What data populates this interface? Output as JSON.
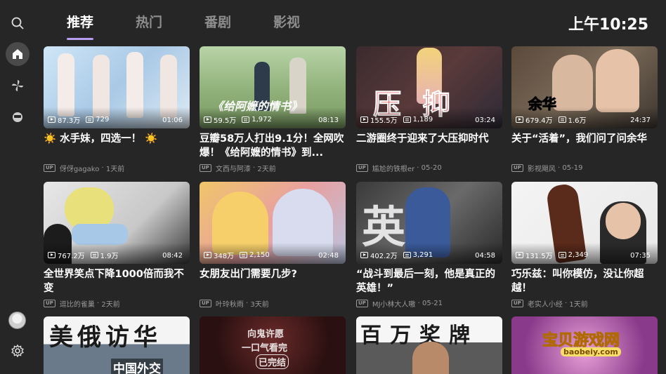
{
  "tabs": [
    {
      "label": "推荐",
      "active": true
    },
    {
      "label": "热门",
      "active": false
    },
    {
      "label": "番剧",
      "active": false
    },
    {
      "label": "影视",
      "active": false
    }
  ],
  "clock": "上午10:25",
  "sidebar": {
    "items": [
      {
        "icon": "search-icon"
      },
      {
        "icon": "home-icon",
        "active": true
      },
      {
        "icon": "pinwheel-icon"
      },
      {
        "icon": "bilibili-tv-icon"
      },
      {
        "icon": "avatar"
      },
      {
        "icon": "gear-icon"
      }
    ]
  },
  "videos": [
    {
      "title": "☀️ 水手妹，四选一！ ☀️",
      "author": "伢伢gagako",
      "date": "1天前",
      "views": "87.3万",
      "danmaku": "729",
      "duration": "01:06",
      "thumb_text": ""
    },
    {
      "title": "豆瓣58万人打出9.1分！全网吹爆！《给阿嬷的情书》到...",
      "author": "文西与阿漆",
      "date": "2天前",
      "views": "59.5万",
      "danmaku": "1,972",
      "duration": "08:13",
      "thumb_text": "《给阿嬷的情书》"
    },
    {
      "title": "二游圈终于迎来了大压抑时代",
      "author": "尴尬的铁根er",
      "date": "05-20",
      "views": "155.5万",
      "danmaku": "1,189",
      "duration": "03:24",
      "thumb_text": "压抑"
    },
    {
      "title": "关于“活着”，我们问了问余华",
      "author": "影视飓风",
      "date": "05-19",
      "views": "679.4万",
      "danmaku": "1.6万",
      "duration": "24:37",
      "thumb_text": "余华"
    },
    {
      "title": "全世界笑点下降1000倍而我不变",
      "author": "逗比的雀巢",
      "date": "2天前",
      "views": "767.2万",
      "danmaku": "1.9万",
      "duration": "08:42",
      "thumb_text": ""
    },
    {
      "title": "女朋友出门需要几步?",
      "author": "叶玲秋雨",
      "date": "3天前",
      "views": "348万",
      "danmaku": "2,150",
      "duration": "02:48",
      "thumb_text": ""
    },
    {
      "title": "“战斗到最后一刻，他是真正的英雄！”",
      "author": "MJ小林大人嗷",
      "date": "05-21",
      "views": "402.2万",
      "danmaku": "3,291",
      "duration": "04:58",
      "thumb_text": "英雄"
    },
    {
      "title": "巧乐兹：叫你模仿，没让你超越！",
      "author": "老实人小经",
      "date": "1天前",
      "views": "131.5万",
      "danmaku": "2,349",
      "duration": "07:35",
      "thumb_text": ""
    },
    {
      "title": "",
      "author": "",
      "date": "",
      "views": "",
      "danmaku": "",
      "duration": "",
      "thumb_text": "美俄访华",
      "thumb_text2": "中国外交"
    },
    {
      "title": "",
      "author": "",
      "date": "",
      "views": "",
      "danmaku": "",
      "duration": "",
      "thumb_text": "向鬼许愿",
      "thumb_text2": "一口气看完",
      "thumb_text3": "已完结"
    },
    {
      "title": "",
      "author": "",
      "date": "",
      "views": "",
      "danmaku": "",
      "duration": "",
      "thumb_text": "百万奖牌"
    },
    {
      "title": "",
      "author": "",
      "date": "",
      "views": "",
      "danmaku": "",
      "duration": "",
      "thumb_text": "宝贝游戏网",
      "thumb_text2": "baobeiy.com"
    }
  ],
  "colors": {
    "background": "#262626",
    "accent": "#b79cf0",
    "inactive_tab": "#8e8e8e"
  }
}
